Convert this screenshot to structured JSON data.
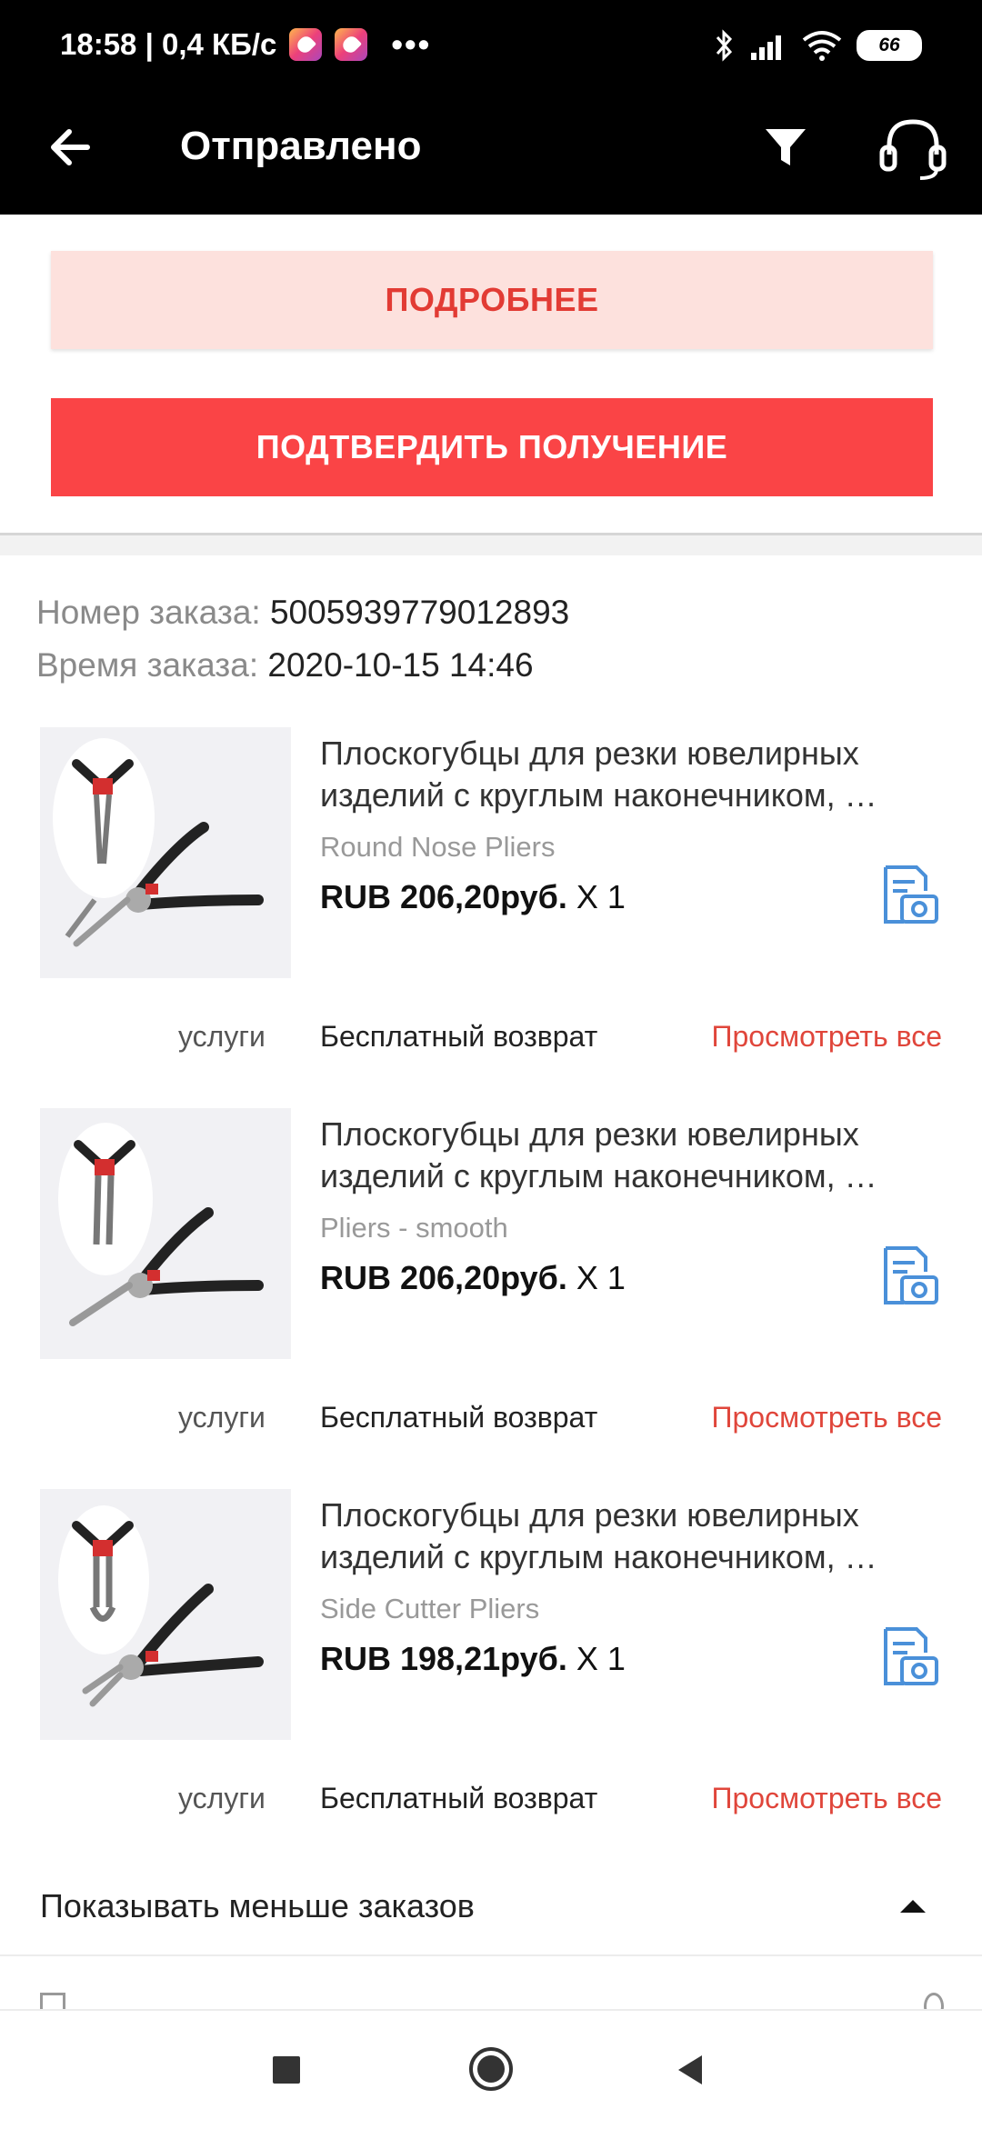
{
  "status_bar": {
    "time_speed": "18:58 | 0,4 КБ/с",
    "dots": "•••",
    "battery": "66"
  },
  "app_bar": {
    "title": "Отправлено"
  },
  "actions": {
    "more_label": "ПОДРОБНЕЕ",
    "confirm_label": "ПОДТВЕРДИТЬ ПОЛУЧЕНИЕ"
  },
  "order": {
    "number_label": "Номер заказа:",
    "number": "5005939779012893",
    "time_label": "Время заказа:",
    "time": "2020-10-15 14:46"
  },
  "items": [
    {
      "title": "Плоскогубцы для резки ювелирных изделий с круглым наконечником, …",
      "variant": "Round Nose Pliers",
      "price": "RUB 206,20руб.",
      "qty": "X 1",
      "services": "услуги",
      "return": "Бесплатный возврат",
      "view_all": "Просмотреть все"
    },
    {
      "title": "Плоскогубцы для резки ювелирных изделий с круглым наконечником, …",
      "variant": "Pliers - smooth",
      "price": "RUB 206,20руб.",
      "qty": "X 1",
      "services": "услуги",
      "return": "Бесплатный возврат",
      "view_all": "Просмотреть все"
    },
    {
      "title": "Плоскогубцы для резки ювелирных изделий с круглым наконечником, …",
      "variant": "Side Cutter Pliers",
      "price": "RUB 198,21руб.",
      "qty": "X 1",
      "services": "услуги",
      "return": "Бесплатный возврат",
      "view_all": "Просмотреть все"
    }
  ],
  "show_less_label": "Показывать меньше заказов",
  "colors": {
    "accent_red": "#fa4446",
    "soft_red": "#fde1dd",
    "link_red": "#e0463b",
    "icon_blue": "#4a90d9"
  }
}
